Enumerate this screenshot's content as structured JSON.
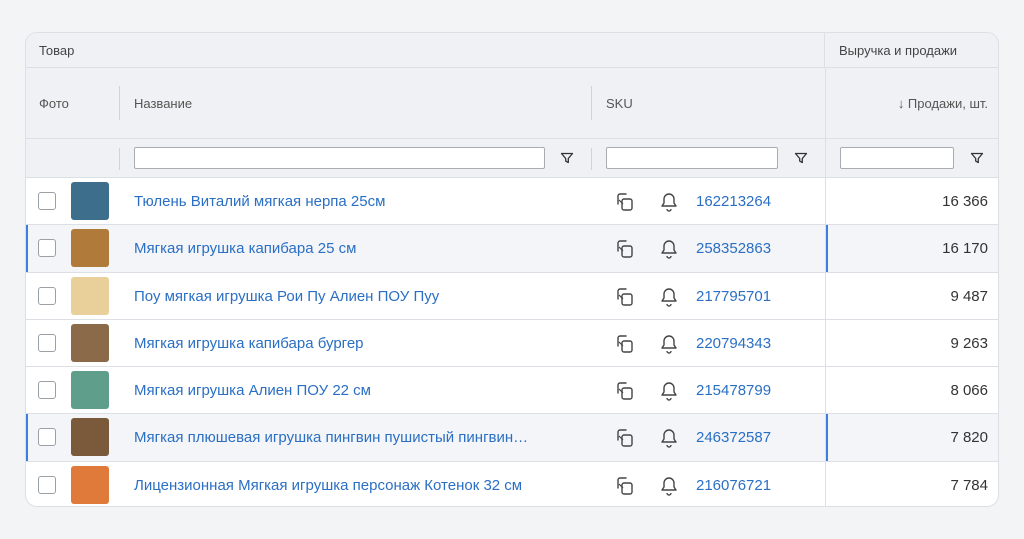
{
  "header": {
    "group_product": "Товар",
    "group_revenue": "Выручка и продажи",
    "col_photo": "Фото",
    "col_name": "Название",
    "col_sku": "SKU",
    "col_sales": "↓ Продажи, шт."
  },
  "rows": [
    {
      "name": "Тюлень Виталий мягкая нерпа 25см",
      "sku": "162213264",
      "sales": "16 366",
      "thumb_color": "#3d6e8c",
      "highlighted": false
    },
    {
      "name": "Мягкая игрушка капибара 25 см",
      "sku": "258352863",
      "sales": "16 170",
      "thumb_color": "#b07a3a",
      "highlighted": true
    },
    {
      "name": "Поу мягкая игрушка Рои Пу Алиен ПОУ Пуу",
      "sku": "217795701",
      "sales": "9 487",
      "thumb_color": "#e9cf9a",
      "highlighted": false
    },
    {
      "name": "Мягкая игрушка капибара бургер",
      "sku": "220794343",
      "sales": "9 263",
      "thumb_color": "#8a6a48",
      "highlighted": false
    },
    {
      "name": "Мягкая игрушка Алиен ПОУ 22 см",
      "sku": "215478799",
      "sales": "8 066",
      "thumb_color": "#5f9e8a",
      "highlighted": false
    },
    {
      "name": "Мягкая плюшевая игрушка пингвин пушистый пингвин…",
      "sku": "246372587",
      "sales": "7 820",
      "thumb_color": "#7a5a3a",
      "highlighted": true
    },
    {
      "name": "Лицензионная Мягкая игрушка персонаж Котенок 32 см",
      "sku": "216076721",
      "sales": "7 784",
      "thumb_color": "#e07a3a",
      "highlighted": false
    }
  ]
}
